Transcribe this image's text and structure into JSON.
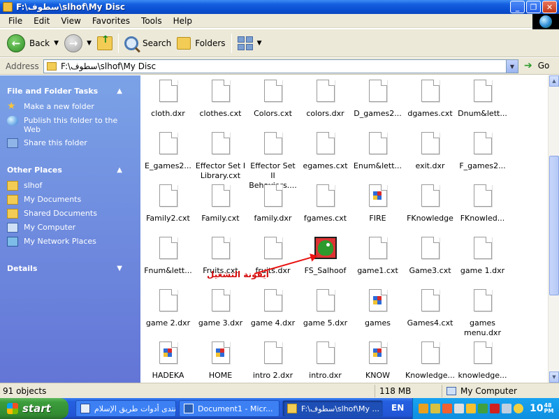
{
  "window": {
    "title": "F:\\سطوف\\slhof\\My Disc",
    "controls": [
      "_",
      "❐",
      "✕"
    ]
  },
  "menu": [
    "File",
    "Edit",
    "View",
    "Favorites",
    "Tools",
    "Help"
  ],
  "toolbar": {
    "back_label": "Back",
    "search_label": "Search",
    "folders_label": "Folders"
  },
  "address": {
    "label": "Address",
    "value": "F:\\سطوف\\slhof\\My Disc",
    "go_label": "Go"
  },
  "left_pane": {
    "tasks_title": "File and Folder Tasks",
    "tasks": [
      "Make a new folder",
      "Publish this folder to the Web",
      "Share this folder"
    ],
    "places_title": "Other Places",
    "places": [
      "slhof",
      "My Documents",
      "Shared Documents",
      "My Computer",
      "My Network Places"
    ],
    "details_title": "Details"
  },
  "files": [
    {
      "name": "cloth.dxr",
      "icon": "file"
    },
    {
      "name": "clothes.cxt",
      "icon": "file"
    },
    {
      "name": "Colors.cxt",
      "icon": "file"
    },
    {
      "name": "colors.dxr",
      "icon": "file"
    },
    {
      "name": "D_games2...",
      "icon": "file"
    },
    {
      "name": "dgames.cxt",
      "icon": "file"
    },
    {
      "name": "Dnum&lett...",
      "icon": "file"
    },
    {
      "name": "E_games2...",
      "icon": "file"
    },
    {
      "name": "Effector Set I Library.cxt",
      "icon": "file"
    },
    {
      "name": "Effector Set II Behaviors....",
      "icon": "file"
    },
    {
      "name": "egames.cxt",
      "icon": "file"
    },
    {
      "name": "Enum&lett...",
      "icon": "file"
    },
    {
      "name": "exit.dxr",
      "icon": "file"
    },
    {
      "name": "F_games2...",
      "icon": "file"
    },
    {
      "name": "Family2.cxt",
      "icon": "file"
    },
    {
      "name": "Family.cxt",
      "icon": "file"
    },
    {
      "name": "family.dxr",
      "icon": "file"
    },
    {
      "name": "fgames.cxt",
      "icon": "file"
    },
    {
      "name": "FIRE",
      "icon": "lingo"
    },
    {
      "name": "FKnowledge",
      "icon": "file"
    },
    {
      "name": "FKnowled...",
      "icon": "file"
    },
    {
      "name": "Fnum&lett...",
      "icon": "file"
    },
    {
      "name": "Fruits.cxt",
      "icon": "file"
    },
    {
      "name": "fruits.dxr",
      "icon": "file"
    },
    {
      "name": "FS_Salhoof",
      "icon": "exe"
    },
    {
      "name": "game1.cxt",
      "icon": "file"
    },
    {
      "name": "Game3.cxt",
      "icon": "file"
    },
    {
      "name": "game 1.dxr",
      "icon": "file"
    },
    {
      "name": "game 2.dxr",
      "icon": "file"
    },
    {
      "name": "game 3.dxr",
      "icon": "file"
    },
    {
      "name": "game 4.dxr",
      "icon": "file"
    },
    {
      "name": "game 5.dxr",
      "icon": "file"
    },
    {
      "name": "games",
      "icon": "lingo"
    },
    {
      "name": "Games4.cxt",
      "icon": "file"
    },
    {
      "name": "games menu.dxr",
      "icon": "file"
    },
    {
      "name": "HADEKA",
      "icon": "lingo"
    },
    {
      "name": "HOME",
      "icon": "lingo"
    },
    {
      "name": "intro 2.dxr",
      "icon": "file"
    },
    {
      "name": "intro.dxr",
      "icon": "file"
    },
    {
      "name": "KNOW",
      "icon": "lingo"
    },
    {
      "name": "Knowledge...",
      "icon": "file"
    },
    {
      "name": "knowledge...",
      "icon": "file"
    }
  ],
  "annotation": "ايقونة التشغيل",
  "status": {
    "objects": "91 objects",
    "size": "118 MB",
    "location": "My Computer"
  },
  "taskbar": {
    "start_label": "start",
    "tasks": [
      {
        "label": "منتدى أدوات طريق الإسلام - ...",
        "icon": "ie"
      },
      {
        "label": "Document1 - Micr...",
        "icon": "word"
      },
      {
        "label": "F:\\سطوف\\slhof\\My ...",
        "icon": "fold"
      }
    ],
    "language": "EN",
    "clock": "10",
    "clock_minutes": "48",
    "clock_ampm": "PM"
  }
}
